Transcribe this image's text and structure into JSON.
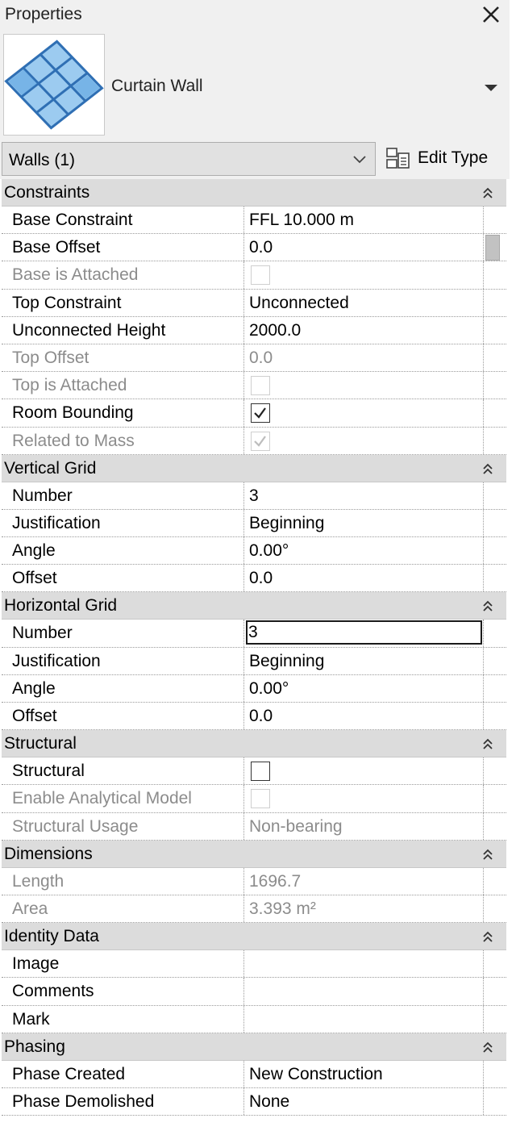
{
  "panel": {
    "title": "Properties"
  },
  "type_selector": {
    "family_type": "Curtain Wall",
    "thumbnail_icon": "curtain-wall-thumbnail"
  },
  "filter": {
    "category": "Walls (1)",
    "edit_type_label": "Edit Type"
  },
  "groups": [
    {
      "label": "Constraints",
      "rows": [
        {
          "name": "Base Constraint",
          "value": "FFL 10.000 m",
          "kind": "text",
          "disabled": false
        },
        {
          "name": "Base Offset",
          "value": "0.0",
          "kind": "text",
          "disabled": false
        },
        {
          "name": "Base is Attached",
          "checked": false,
          "kind": "checkbox",
          "disabled": true
        },
        {
          "name": "Top Constraint",
          "value": "Unconnected",
          "kind": "text",
          "disabled": false
        },
        {
          "name": "Unconnected Height",
          "value": "2000.0",
          "kind": "text",
          "disabled": false
        },
        {
          "name": "Top Offset",
          "value": "0.0",
          "kind": "text",
          "disabled": true
        },
        {
          "name": "Top is Attached",
          "checked": false,
          "kind": "checkbox",
          "disabled": true
        },
        {
          "name": "Room Bounding",
          "checked": true,
          "kind": "checkbox",
          "disabled": false
        },
        {
          "name": "Related to Mass",
          "checked": true,
          "kind": "checkbox",
          "disabled": true
        }
      ]
    },
    {
      "label": "Vertical Grid",
      "rows": [
        {
          "name": "Number",
          "value": "3",
          "kind": "text",
          "disabled": false
        },
        {
          "name": "Justification",
          "value": "Beginning",
          "kind": "text",
          "disabled": false
        },
        {
          "name": "Angle",
          "value": "0.00°",
          "kind": "text",
          "disabled": false
        },
        {
          "name": "Offset",
          "value": "0.0",
          "kind": "text",
          "disabled": false
        }
      ]
    },
    {
      "label": "Horizontal Grid",
      "rows": [
        {
          "name": "Number",
          "value": "3",
          "kind": "input",
          "disabled": false
        },
        {
          "name": "Justification",
          "value": "Beginning",
          "kind": "text",
          "disabled": false
        },
        {
          "name": "Angle",
          "value": "0.00°",
          "kind": "text",
          "disabled": false
        },
        {
          "name": "Offset",
          "value": "0.0",
          "kind": "text",
          "disabled": false
        }
      ]
    },
    {
      "label": "Structural",
      "rows": [
        {
          "name": "Structural",
          "checked": false,
          "kind": "checkbox",
          "disabled": false
        },
        {
          "name": "Enable Analytical Model",
          "checked": false,
          "kind": "checkbox",
          "disabled": true
        },
        {
          "name": "Structural Usage",
          "value": "Non-bearing",
          "kind": "text",
          "disabled": true
        }
      ]
    },
    {
      "label": "Dimensions",
      "rows": [
        {
          "name": "Length",
          "value": "1696.7",
          "kind": "text",
          "disabled": true
        },
        {
          "name": "Area",
          "value": "3.393 m²",
          "kind": "text",
          "disabled": true
        }
      ]
    },
    {
      "label": "Identity Data",
      "rows": [
        {
          "name": "Image",
          "value": "",
          "kind": "text",
          "disabled": false
        },
        {
          "name": "Comments",
          "value": "",
          "kind": "text",
          "disabled": false
        },
        {
          "name": "Mark",
          "value": "",
          "kind": "text",
          "disabled": false
        }
      ]
    },
    {
      "label": "Phasing",
      "rows": [
        {
          "name": "Phase Created",
          "value": "New Construction",
          "kind": "text",
          "disabled": false
        },
        {
          "name": "Phase Demolished",
          "value": "None",
          "kind": "text",
          "disabled": false
        }
      ]
    }
  ],
  "colors": {
    "title_bg": "#f0f0f0",
    "group_bg": "#dcdcdc",
    "disabled_text": "#8c8c8c",
    "thumbnail_blue": "#5aa3e0"
  }
}
